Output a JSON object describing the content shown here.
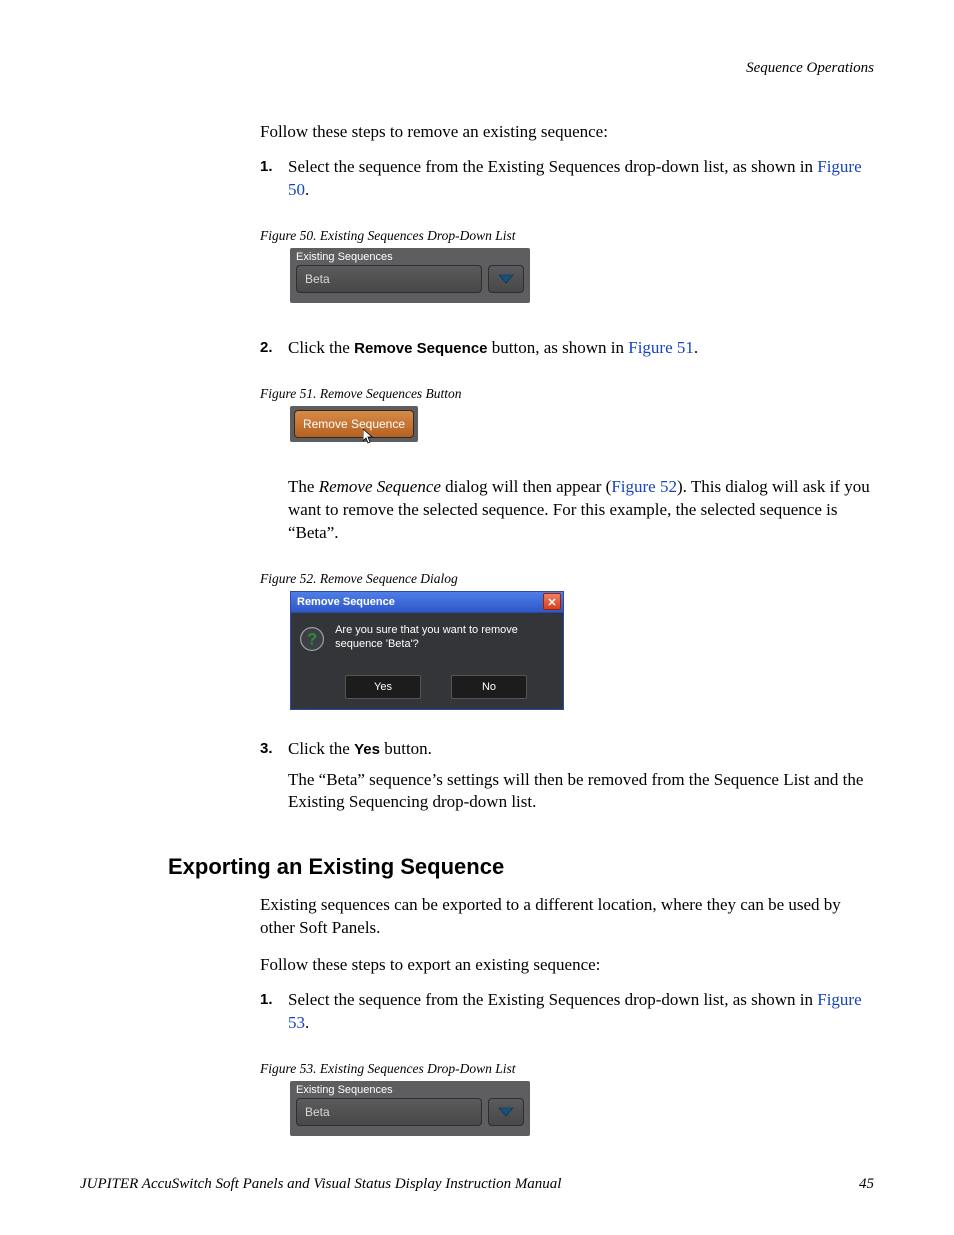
{
  "running_head": "Sequence Operations",
  "intro": "Follow these steps to remove an existing sequence:",
  "steps_remove": [
    {
      "num": "1.",
      "pre": "Select the sequence from the Existing Sequences drop-down list, as shown in ",
      "link": "Figure 50",
      "post": "."
    },
    {
      "num": "2.",
      "pre": "Click the ",
      "bold": "Remove Sequence",
      "mid": " button, as shown in ",
      "link": "Figure 51",
      "post": "."
    },
    {
      "num": "3.",
      "pre": "Click the ",
      "bold": "Yes",
      "post": " button."
    }
  ],
  "fig50": {
    "caption": "Figure 50.  Existing Sequences Drop-Down List",
    "header": "Existing Sequences",
    "value": "Beta"
  },
  "fig51": {
    "caption": "Figure 51.  Remove Sequences Button",
    "label": "Remove Sequence"
  },
  "after_fig51_para": {
    "pre": "The ",
    "ital": "Remove Sequence",
    "mid": " dialog will then appear (",
    "link": "Figure 52",
    "post": "). This dialog will ask if you want to remove the selected sequence. For this example, the selected sequence is “Beta”."
  },
  "fig52": {
    "caption": "Figure 52.  Remove Sequence Dialog",
    "title": "Remove Sequence",
    "message": "Are you sure that you want to remove sequence 'Beta'?",
    "yes": "Yes",
    "no": "No"
  },
  "after_step3_para": "The “Beta” sequence’s settings will then be removed from the Sequence List and the Existing Sequencing drop-down list.",
  "export": {
    "heading": "Exporting an Existing Sequence",
    "intro": "Existing sequences can be exported to a different location, where they can be used by other Soft Panels.",
    "follow": "Follow these steps to export an existing sequence:",
    "step1": {
      "num": "1.",
      "pre": "Select the sequence from the Existing Sequences drop-down list, as shown in ",
      "link": "Figure 53",
      "post": "."
    }
  },
  "fig53": {
    "caption": "Figure 53.  Existing Sequences Drop-Down List",
    "header": "Existing Sequences",
    "value": "Beta"
  },
  "footer": {
    "title": "JUPITER AccuSwitch Soft Panels and Visual Status Display Instruction Manual",
    "page": "45"
  }
}
